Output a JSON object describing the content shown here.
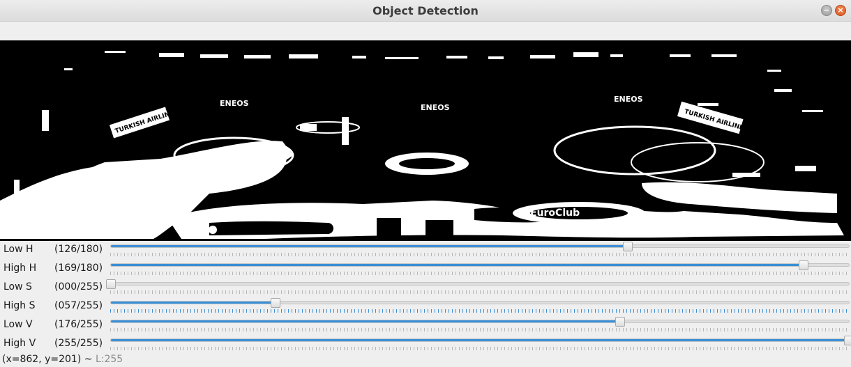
{
  "window": {
    "title": "Object Detection",
    "buttons": [
      "minimize-icon",
      "close-icon"
    ],
    "minimize_glyph": "−",
    "close_glyph": "×"
  },
  "viewport": {
    "description_colors": {
      "background": "#000000",
      "foreground": "#ffffff"
    },
    "visible_text": [
      "TURKISH AIRLINES",
      "ENEOS",
      "ENEOS",
      "ENEOS",
      "TURKISH AIRLINES",
      "EuroClub"
    ]
  },
  "sliders": [
    {
      "label": "Low H",
      "value_text": "(126/180)",
      "value": 126,
      "max": 180
    },
    {
      "label": "High H",
      "value_text": "(169/180)",
      "value": 169,
      "max": 180
    },
    {
      "label": "Low S",
      "value_text": "(000/255)",
      "value": 0,
      "max": 255
    },
    {
      "label": "High S",
      "value_text": "(057/255)",
      "value": 57,
      "max": 255
    },
    {
      "label": "Low V",
      "value_text": "(176/255)",
      "value": 176,
      "max": 255
    },
    {
      "label": "High V",
      "value_text": "(255/255)",
      "value": 255,
      "max": 255
    }
  ],
  "status": {
    "coords": "(x=862, y=201) ~ ",
    "luminance": "L:255"
  },
  "colors": {
    "accent": "#3a8fd6",
    "close_button": "#d9541b"
  }
}
